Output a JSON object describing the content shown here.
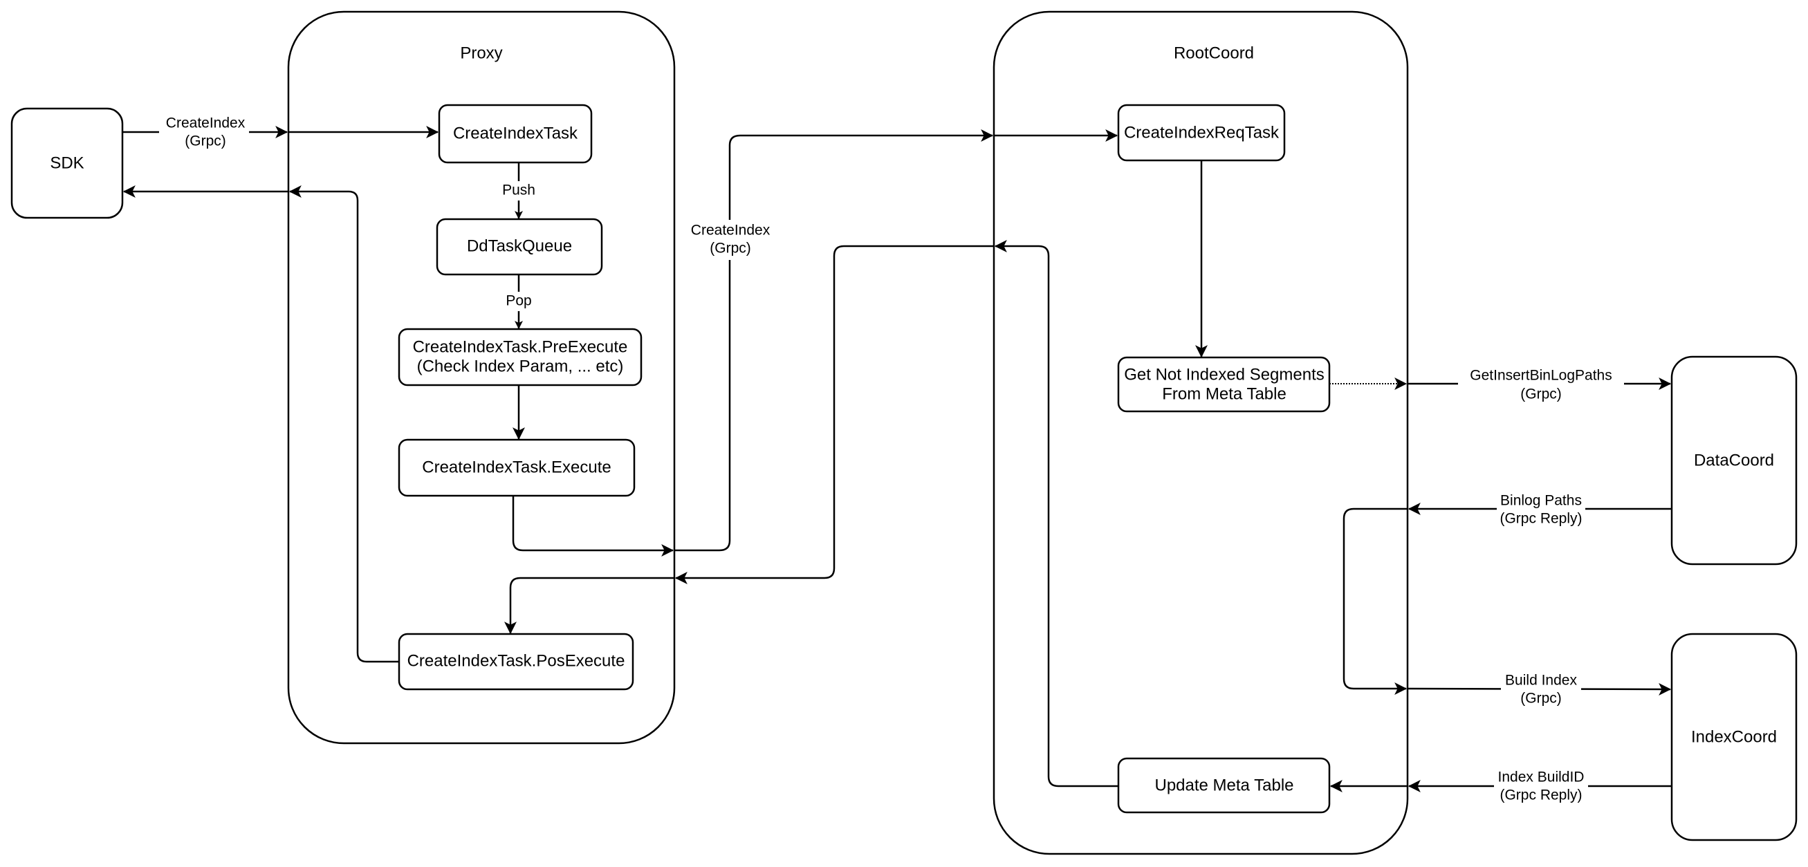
{
  "diagram": {
    "type": "sequence-flow",
    "containers": {
      "proxy": {
        "label": "Proxy"
      },
      "rootcoord": {
        "label": "RootCoord"
      }
    },
    "nodes": {
      "sdk": "SDK",
      "create_index_task": "CreateIndexTask",
      "dd_task_queue": "DdTaskQueue",
      "pre_execute": [
        "CreateIndexTask.PreExecute",
        "(Check Index Param, ... etc)"
      ],
      "execute": "CreateIndexTask.Execute",
      "pos_execute": "CreateIndexTask.PosExecute",
      "create_index_req_task": "CreateIndexReqTask",
      "get_not_indexed": [
        "Get Not Indexed Segments",
        "From Meta Table"
      ],
      "update_meta": "Update Meta Table",
      "datacoord": "DataCoord",
      "indexcoord": "IndexCoord"
    },
    "edge_labels": {
      "sdk_to_proxy": [
        "CreateIndex",
        "(Grpc)"
      ],
      "push": "Push",
      "pop": "Pop",
      "proxy_to_rootcoord": [
        "CreateIndex",
        "(Grpc)"
      ],
      "get_insert_binlog_paths": [
        "GetInsertBinLogPaths",
        "(Grpc)"
      ],
      "binlog_paths": [
        "Binlog Paths",
        "(Grpc Reply)"
      ],
      "build_index": [
        "Build Index",
        "(Grpc)"
      ],
      "index_build_id": [
        "Index BuildID",
        "(Grpc Reply)"
      ]
    }
  }
}
